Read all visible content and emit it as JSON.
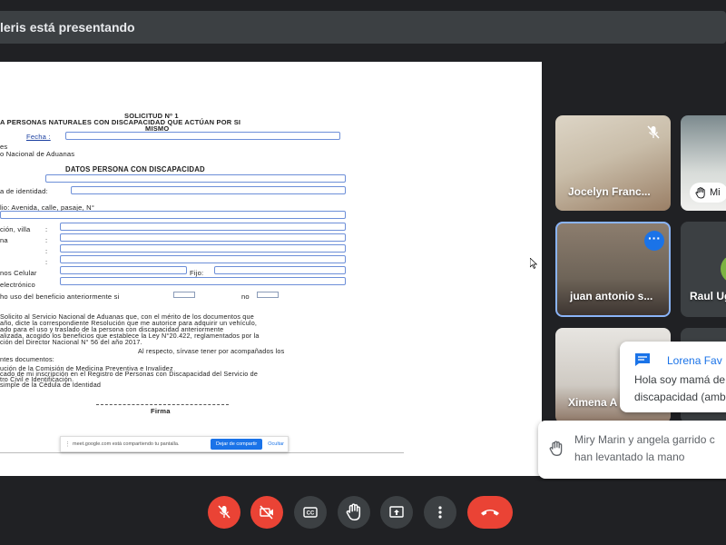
{
  "banner": {
    "presenting_text": "leris está presentando"
  },
  "document": {
    "title_1": "SOLICITUD Nº 1",
    "title_2": "A PERSONAS NATURALES CON DISCAPACIDAD QUE ACTÚAN POR SI",
    "title_3": "MISMO",
    "fecha_label": "Fecha :",
    "line_es": "es",
    "line_aduanas": "o Nacional de Aduanas",
    "section_title": "DATOS PERSONA CON DISCAPACIDAD",
    "identidad_label": "a de identidad:",
    "domicilio_label": "lio: Avenida, calle, pasaje, N°",
    "villa_label": "ción, villa",
    "colon": ":",
    "field_na": "na",
    "telefonos_label": "nos  Celular",
    "fijo_label": "Fijo:",
    "electronico_label": "electrónico",
    "beneficio_label": "ho uso del beneficio anteriormente si",
    "no_label": "no",
    "para_1": "Solicito al Servicio Nacional de Aduanas que, con el mérito de los documentos que",
    "para_2": "año, dicte la correspondiente Resolución que me autorice para adquirir un vehículo,",
    "para_3": "ado   para  el  uso  y  traslado  de  la  persona  con  discapacidad  anteriormente",
    "para_4": "alizada, acogido los beneficios que establece la Ley N°20.422, reglamentados por la",
    "para_5": "ción del Director Nacional N° 56 del año 2017.",
    "para_6": "Al  respecto,  sírvase  tener  por  acompañados  los",
    "docs_label": "ntes documentos:",
    "doc_1": "ución de la Comisión de Medicina Preventiva e Invalidez",
    "doc_2": "cado de mi inscripción en el Registro de Personas con Discapacidad del Servicio de",
    "doc_3": "tro Civil e Identificación.",
    "doc_4": "simple de la Cédula de Identidad",
    "firma_label": "Firma"
  },
  "share_notice": {
    "message": "meet.google.com está compartiendo tu pantalla.",
    "stop_label": "Dejar de compartir",
    "hide_label": "Ocultar"
  },
  "participants": [
    {
      "name": "Jocelyn Franc...",
      "muted": true
    },
    {
      "name": "Mi",
      "hand_raised": true
    },
    {
      "name": "juan antonio s...",
      "active": true
    },
    {
      "name": "Raul Ug",
      "avatar_color": "#7cb342"
    },
    {
      "name": "Ximena A"
    }
  ],
  "chat_popup": {
    "sender": "Lorena Fav",
    "line_1": "Hola soy mamá de",
    "line_2": "discapacidad (amb"
  },
  "hand_notice": {
    "line_1": "Miry Marin y angela garrido c",
    "line_2": "han levantado la mano"
  },
  "colors": {
    "accent": "#1a73e8",
    "danger": "#ea4335",
    "background": "#202124",
    "control_gray": "#3c4043"
  }
}
